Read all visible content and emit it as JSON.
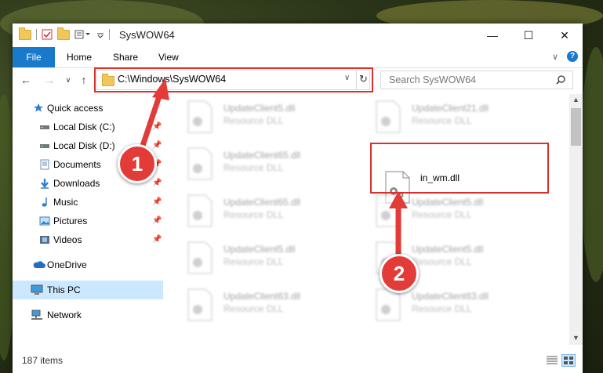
{
  "window": {
    "title": "SysWOW64"
  },
  "ribbon": {
    "tabs": [
      "File",
      "Home",
      "Share",
      "View"
    ]
  },
  "address": {
    "path": "C:\\Windows\\SysWOW64"
  },
  "search": {
    "placeholder": "Search SysWOW64"
  },
  "sidebar": {
    "items": [
      {
        "label": "Quick access",
        "icon": "star-icon"
      },
      {
        "label": "Local Disk (C:)",
        "icon": "drive-icon",
        "pinned": true
      },
      {
        "label": "Local Disk (D:)",
        "icon": "drive-icon",
        "pinned": true
      },
      {
        "label": "Documents",
        "icon": "documents-icon",
        "pinned": true
      },
      {
        "label": "Downloads",
        "icon": "download-arrow-icon",
        "pinned": true
      },
      {
        "label": "Music",
        "icon": "music-note-icon",
        "pinned": true
      },
      {
        "label": "Pictures",
        "icon": "pictures-icon",
        "pinned": true
      },
      {
        "label": "Videos",
        "icon": "film-icon",
        "pinned": true
      },
      {
        "label": "OneDrive",
        "icon": "cloud-icon"
      },
      {
        "label": "This PC",
        "icon": "computer-icon",
        "selected": true
      },
      {
        "label": "Network",
        "icon": "network-icon"
      }
    ]
  },
  "files": [
    {
      "name": "UpdateClient5.dll",
      "type": "Resource DLL"
    },
    {
      "name": "UpdateClient21.dll",
      "type": "Resource DLL"
    },
    {
      "name": "UpdateClient65.dll",
      "type": "Resource DLL"
    },
    {
      "name": "in_wm.dll",
      "type": ""
    },
    {
      "name": "UpdateClient65.dll",
      "type": "Resource DLL"
    },
    {
      "name": "UpdateClient5.dll",
      "type": "Resource DLL"
    },
    {
      "name": "UpdateClient5.dll",
      "type": "Resource DLL"
    },
    {
      "name": "UpdateClient5.dll",
      "type": "Resource DLL"
    },
    {
      "name": "UpdateClient63.dll",
      "type": "Resource DLL"
    },
    {
      "name": "UpdateClient63.dll",
      "type": "Resource DLL"
    }
  ],
  "status": {
    "item_count": "187 items"
  },
  "annotations": {
    "step1": "1",
    "step2": "2"
  },
  "colors": {
    "accent": "#1979ca",
    "highlight": "#d9302c",
    "selected_bg": "#cce8ff"
  }
}
